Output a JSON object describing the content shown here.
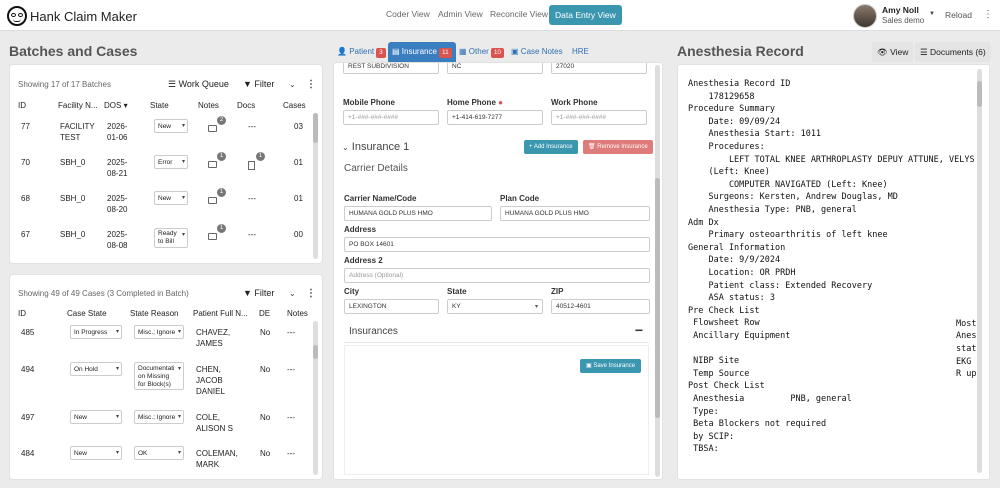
{
  "app": {
    "title": "Hank Claim Maker"
  },
  "nav": {
    "coder": "Coder View",
    "admin": "Admin View",
    "reconcile": "Reconcile View",
    "dataentry": "Data Entry View"
  },
  "user": {
    "name": "Amy Noll",
    "role": "Sales demo",
    "reload": "Reload"
  },
  "left": {
    "title": "Batches and Cases"
  },
  "batches": {
    "showing": "Showing 17 of 17 Batches",
    "work_queue": "Work Queue",
    "filter": "Filter",
    "headers": [
      "ID",
      "Facility N...",
      "DOS",
      "State",
      "Notes",
      "Docs",
      "Cases"
    ],
    "rows": [
      {
        "id": "77",
        "facility": "FACILITY\nTEST",
        "dos": "2026-\n01-06",
        "state": "New",
        "notes_count": "2",
        "docs": "---",
        "cases": "03"
      },
      {
        "id": "70",
        "facility": "SBH_0",
        "dos": "2025-\n08-21",
        "state": "Error",
        "notes_count": "1",
        "docs_count": "1",
        "cases": "01"
      },
      {
        "id": "68",
        "facility": "SBH_0",
        "dos": "2025-\n08-20",
        "state": "New",
        "notes_count": "1",
        "docs": "---",
        "cases": "01"
      },
      {
        "id": "67",
        "facility": "SBH_0",
        "dos": "2025-\n08-08",
        "state": "Ready\nto Bill",
        "notes_count": "1",
        "docs": "---",
        "cases": "00"
      }
    ]
  },
  "cases": {
    "showing": "Showing 49 of 49 Cases (3 Completed in Batch)",
    "filter": "Filter",
    "headers": [
      "ID",
      "Case State",
      "State Reason",
      "Patient Full N...",
      "DE",
      "Notes"
    ],
    "rows": [
      {
        "id": "485",
        "state": "In Progress",
        "reason": "Misc.; Ignore",
        "patient": "CHAVEZ,\nJAMES",
        "de": "No",
        "notes": "---"
      },
      {
        "id": "494",
        "state": "On Hold",
        "reason": "Documentati\non Missing\nfor Block(s)",
        "patient": "CHEN,\nJACOB\nDANIEL",
        "de": "No",
        "notes": "---"
      },
      {
        "id": "497",
        "state": "New",
        "reason": "Misc.; Ignore",
        "patient": "COLE,\nALISON S",
        "de": "No",
        "notes": "---"
      },
      {
        "id": "484",
        "state": "New",
        "reason": "OK",
        "patient": "COLEMAN,\nMARK",
        "de": "No",
        "notes": "---"
      }
    ]
  },
  "tabs": {
    "patient": "Patient",
    "patient_badge": "3",
    "insurance": "Insurance",
    "insurance_badge": "11",
    "other": "Other",
    "other_badge": "10",
    "case_notes": "Case Notes",
    "hre": "HRE"
  },
  "form": {
    "top_partial": [
      "REST SUBDIVISION",
      "NC",
      "27020"
    ],
    "mobile_label": "Mobile Phone",
    "mobile_ph": "+1-###-###-####",
    "home_label": "Home Phone",
    "home_value": "+1-414-619-7277",
    "work_label": "Work Phone",
    "work_ph": "+1-###-###-####",
    "insurance_title": "Insurance 1",
    "add_insurance": "+ Add Insurance",
    "remove_insurance": "Remove Insurance",
    "carrier_details": "Carrier Details",
    "carrier_label": "Carrier Name/Code",
    "carrier_value": "HUMANA GOLD PLUS HMO",
    "plan_label": "Plan Code",
    "plan_value": "HUMANA GOLD PLUS HMO",
    "address_label": "Address",
    "address_value": "PO BOX 14601",
    "address2_label": "Address 2",
    "address2_ph": "Address (Optional)",
    "city_label": "City",
    "city_value": "LEXINGTON",
    "state_label": "State",
    "state_value": "KY",
    "zip_label": "ZIP",
    "zip_value": "40512-4601",
    "insurances": "Insurances",
    "save_insurance": "Save Insurance"
  },
  "right": {
    "title": "Anesthesia Record",
    "view": "View",
    "documents": "Documents (6)",
    "lines": [
      "Anesthesia Record ID",
      "    178129658",
      "Procedure Summary",
      "    Date: 09/09/24",
      "    Anesthesia Start: 1011",
      "    Procedures:",
      "        LEFT TOTAL KNEE ARTHROPLASTY DEPUY ATTUNE, VELYS",
      "    (Left: Knee)",
      "        COMPUTER NAVIGATED (Left: Knee)",
      "    Surgeons: Kersten, Andrew Douglas, MD",
      "    Anesthesia Type: PNB, general",
      "Adm Dx",
      "    Primary osteoarthritis of left knee",
      "General Information",
      "    Date: 9/9/2024",
      "    Location: OR PRDH",
      "    Patient class: Extended Recovery",
      "    ASA status: 3",
      "Pre Check List",
      " Flowsheet Row",
      " Ancillary Equipment",
      "",
      " NIBP Site",
      " Temp Source",
      "Post Check List",
      " Anesthesia         PNB, general",
      " Type:",
      " Beta Blockers not required",
      " by SCIP:",
      " TBSA:"
    ],
    "right_col": [
      "Most",
      "Anes",
      "stat",
      "EKG",
      "R up"
    ]
  }
}
